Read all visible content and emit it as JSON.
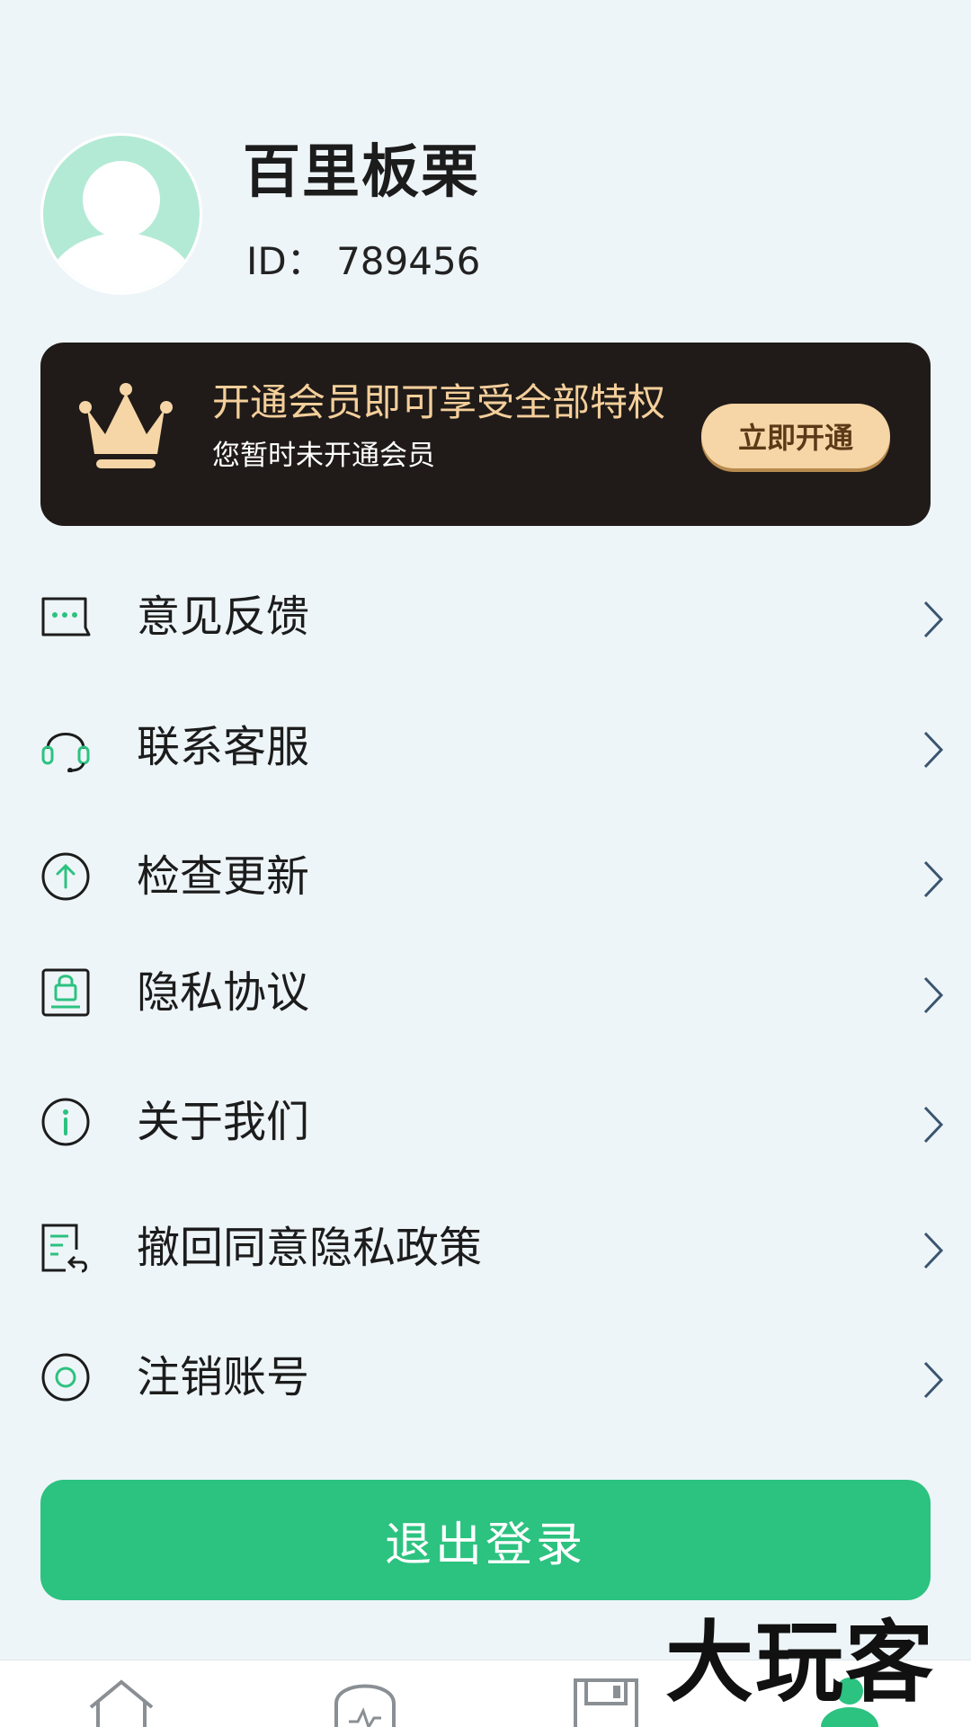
{
  "profile": {
    "name": "百里板栗",
    "id_text": "ID：  789456"
  },
  "vip": {
    "title": "开通会员即可享受全部特权",
    "subtitle": "您暂时未开通会员",
    "button": "立即开通"
  },
  "menu": [
    {
      "label": "意见反馈",
      "icon": "feedback-icon"
    },
    {
      "label": "联系客服",
      "icon": "headset-icon"
    },
    {
      "label": "检查更新",
      "icon": "update-icon"
    },
    {
      "label": "隐私协议",
      "icon": "privacy-lock-icon"
    },
    {
      "label": "关于我们",
      "icon": "info-icon"
    },
    {
      "label": "撤回同意隐私政策",
      "icon": "revoke-document-icon"
    },
    {
      "label": "注销账号",
      "icon": "cancel-account-icon"
    }
  ],
  "logout_label": "退出登录",
  "watermark": "大玩客",
  "tabbar": [
    "home-icon",
    "activity-icon",
    "save-icon",
    "profile-icon"
  ],
  "colors": {
    "accent": "#2cc280",
    "vip_bg": "#201b18",
    "vip_gold": "#f4cf9b",
    "page_bg": "#eef5f8"
  }
}
